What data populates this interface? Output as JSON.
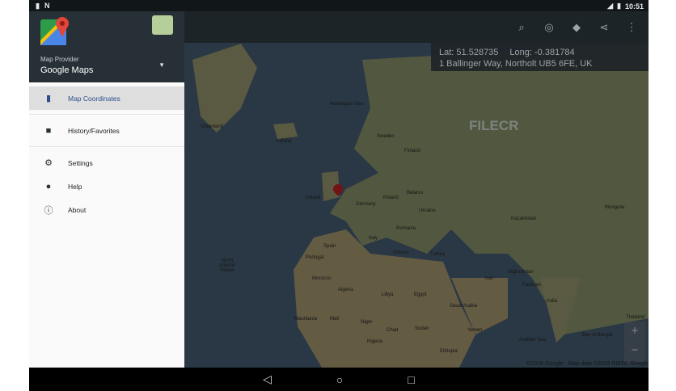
{
  "status_bar": {
    "time": "10:51",
    "left_icons": [
      "sd-card-icon",
      "n-notification-icon"
    ],
    "right_icons": [
      "signal-icon",
      "battery-icon"
    ]
  },
  "drawer": {
    "provider_label": "Map Provider",
    "provider_value": "Google Maps",
    "items": [
      {
        "label": "Map Coordinates",
        "icon": "map-icon",
        "active": true
      },
      {
        "label": "History/Favorites",
        "icon": "history-icon"
      },
      {
        "label": "Settings",
        "icon": "gear-icon"
      },
      {
        "label": "Help",
        "icon": "help-icon"
      },
      {
        "label": "About",
        "icon": "info-icon"
      }
    ]
  },
  "toolbar": {
    "icons": [
      "search-icon",
      "my-location-icon",
      "directions-icon",
      "share-icon",
      "more-icon"
    ]
  },
  "coords": {
    "lat_label": "Lat:",
    "lat": "51.528735",
    "long_label": "Long:",
    "long": "-0.381784",
    "address": "1 Ballinger Way, Northolt UB5 6FE, UK"
  },
  "map": {
    "labels": [
      "Greenland",
      "Norwegian Sea",
      "Iceland",
      "Sweden",
      "Finland",
      "Ireland",
      "Poland",
      "Belarus",
      "Germany",
      "Ukraine",
      "Romania",
      "Spain",
      "Italy",
      "Portugal",
      "Greece",
      "Turkey",
      "Kazakhstan",
      "Morocco",
      "Algeria",
      "Libya",
      "Egypt",
      "Mali",
      "Niger",
      "Chad",
      "Sudan",
      "Saudi Arabia",
      "Iran",
      "Afghanistan",
      "Pakistan",
      "India",
      "Mongolia",
      "North Atlantic Ocean",
      "Mauritania",
      "Nigeria",
      "Ethiopia",
      "Yemen",
      "Arabian Sea",
      "Bay of Bengal",
      "Thailand"
    ],
    "watermark": "FILECR",
    "copyright": "©2018 Google · Map data ©2018 INEGI, Geogle",
    "zoom_in": "+",
    "zoom_out": "−"
  },
  "navbar": {
    "back": "◁",
    "home": "○",
    "recents": "□"
  }
}
